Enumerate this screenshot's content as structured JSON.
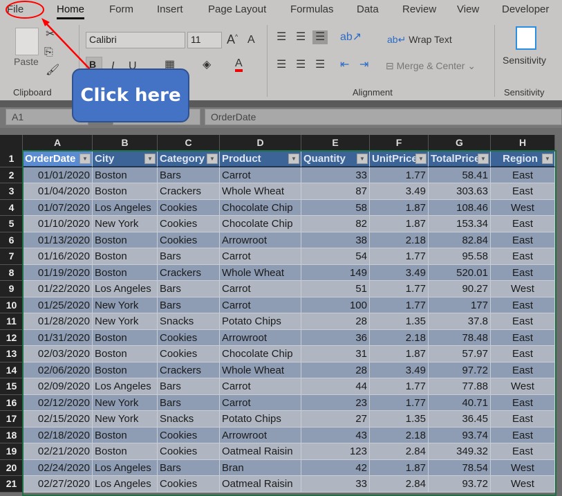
{
  "tabs": [
    "File",
    "Home",
    "Form",
    "Insert",
    "Page Layout",
    "Formulas",
    "Data",
    "Review",
    "View",
    "Developer"
  ],
  "active_tab": "Home",
  "clipboard": {
    "paste": "Paste",
    "label": "Clipboard"
  },
  "font": {
    "name": "Calibri",
    "size": "11",
    "bold": "B",
    "italic": "I",
    "underline": "U"
  },
  "alignment": {
    "wrap_text": "Wrap Text",
    "merge_center": "Merge & Center",
    "label": "Alignment"
  },
  "sensitivity": {
    "button": "Sensitivity",
    "label": "Sensitivity"
  },
  "formula_bar": {
    "name_box": "A1",
    "value": "OrderDate"
  },
  "annotation": {
    "callout": "Click here",
    "color": "#4472c4",
    "arrow_color": "#ff0000"
  },
  "columns": [
    "A",
    "B",
    "C",
    "D",
    "E",
    "F",
    "G",
    "H"
  ],
  "headers": [
    "OrderDate",
    "City",
    "Category",
    "Product",
    "Quantity",
    "UnitPrice",
    "TotalPrice",
    "Region"
  ],
  "rows": [
    [
      "01/01/2020",
      "Boston",
      "Bars",
      "Carrot",
      "33",
      "1.77",
      "58.41",
      "East"
    ],
    [
      "01/04/2020",
      "Boston",
      "Crackers",
      "Whole Wheat",
      "87",
      "3.49",
      "303.63",
      "East"
    ],
    [
      "01/07/2020",
      "Los Angeles",
      "Cookies",
      "Chocolate Chip",
      "58",
      "1.87",
      "108.46",
      "West"
    ],
    [
      "01/10/2020",
      "New York",
      "Cookies",
      "Chocolate Chip",
      "82",
      "1.87",
      "153.34",
      "East"
    ],
    [
      "01/13/2020",
      "Boston",
      "Cookies",
      "Arrowroot",
      "38",
      "2.18",
      "82.84",
      "East"
    ],
    [
      "01/16/2020",
      "Boston",
      "Bars",
      "Carrot",
      "54",
      "1.77",
      "95.58",
      "East"
    ],
    [
      "01/19/2020",
      "Boston",
      "Crackers",
      "Whole Wheat",
      "149",
      "3.49",
      "520.01",
      "East"
    ],
    [
      "01/22/2020",
      "Los Angeles",
      "Bars",
      "Carrot",
      "51",
      "1.77",
      "90.27",
      "West"
    ],
    [
      "01/25/2020",
      "New York",
      "Bars",
      "Carrot",
      "100",
      "1.77",
      "177",
      "East"
    ],
    [
      "01/28/2020",
      "New York",
      "Snacks",
      "Potato Chips",
      "28",
      "1.35",
      "37.8",
      "East"
    ],
    [
      "01/31/2020",
      "Boston",
      "Cookies",
      "Arrowroot",
      "36",
      "2.18",
      "78.48",
      "East"
    ],
    [
      "02/03/2020",
      "Boston",
      "Cookies",
      "Chocolate Chip",
      "31",
      "1.87",
      "57.97",
      "East"
    ],
    [
      "02/06/2020",
      "Boston",
      "Crackers",
      "Whole Wheat",
      "28",
      "3.49",
      "97.72",
      "East"
    ],
    [
      "02/09/2020",
      "Los Angeles",
      "Bars",
      "Carrot",
      "44",
      "1.77",
      "77.88",
      "West"
    ],
    [
      "02/12/2020",
      "New York",
      "Bars",
      "Carrot",
      "23",
      "1.77",
      "40.71",
      "East"
    ],
    [
      "02/15/2020",
      "New York",
      "Snacks",
      "Potato Chips",
      "27",
      "1.35",
      "36.45",
      "East"
    ],
    [
      "02/18/2020",
      "Boston",
      "Cookies",
      "Arrowroot",
      "43",
      "2.18",
      "93.74",
      "East"
    ],
    [
      "02/21/2020",
      "Boston",
      "Cookies",
      "Oatmeal Raisin",
      "123",
      "2.84",
      "349.32",
      "East"
    ],
    [
      "02/24/2020",
      "Los Angeles",
      "Bars",
      "Bran",
      "42",
      "1.87",
      "78.54",
      "West"
    ],
    [
      "02/27/2020",
      "Los Angeles",
      "Cookies",
      "Oatmeal Raisin",
      "33",
      "2.84",
      "93.72",
      "West"
    ]
  ]
}
